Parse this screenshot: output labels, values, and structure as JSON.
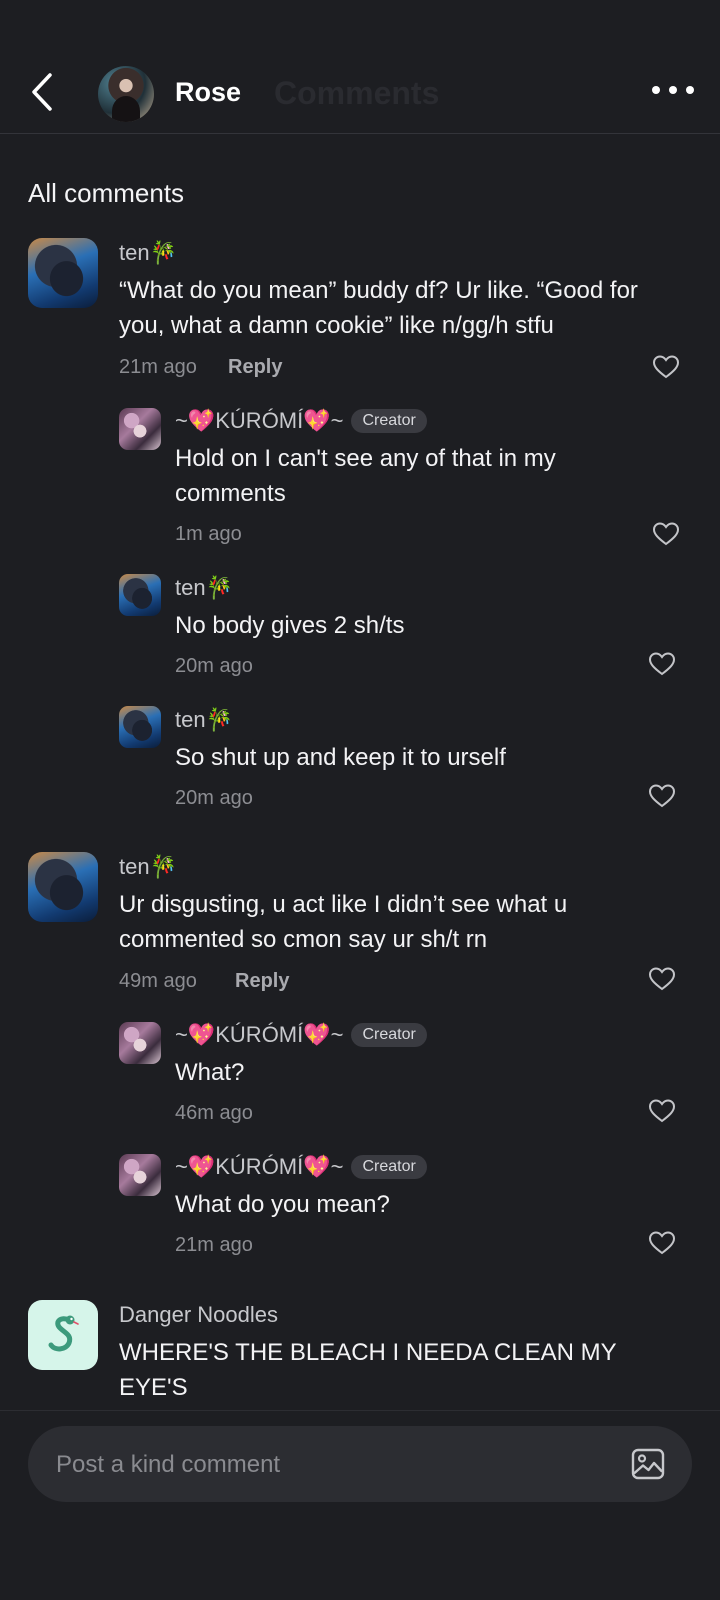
{
  "header": {
    "name": "Rose",
    "ghost_title": "Comments"
  },
  "section_title": "All comments",
  "comments": [
    {
      "name": "ten🎋",
      "text": "“What do you mean” buddy df? Ur like. “Good for you, what a damn cookie” like n/gg/h stfu",
      "time": "21m ago",
      "reply_label": "Reply",
      "replies": [
        {
          "name": "~💖KÚRÓMÍ💖~",
          "badge": "Creator",
          "text": "Hold on I can't see any of that in my comments",
          "time": "1m ago"
        },
        {
          "name": "ten🎋",
          "text": "No body gives 2 sh/ts",
          "time": "20m ago"
        },
        {
          "name": "ten🎋",
          "text": "So shut up and keep it to urself",
          "time": "20m ago"
        }
      ]
    },
    {
      "name": "ten🎋",
      "text": "Ur disgusting, u act like I didn’t see what u commented so cmon say ur sh/t rn",
      "time": "49m ago",
      "reply_label": "Reply",
      "replies": [
        {
          "name": "~💖KÚRÓMÍ💖~",
          "badge": "Creator",
          "text": "What?",
          "time": "46m ago"
        },
        {
          "name": "~💖KÚRÓMÍ💖~",
          "badge": "Creator",
          "text": "What do you mean?",
          "time": "21m ago"
        }
      ]
    },
    {
      "name": "Danger Noodles",
      "text": "WHERE'S THE BLEACH I NEEDA CLEAN MY EYE'S"
    }
  ],
  "composer": {
    "placeholder": "Post a kind comment"
  },
  "colors": {
    "background": "#1d1e22",
    "composer": "#2c2d32",
    "badge": "#3a3b41"
  }
}
